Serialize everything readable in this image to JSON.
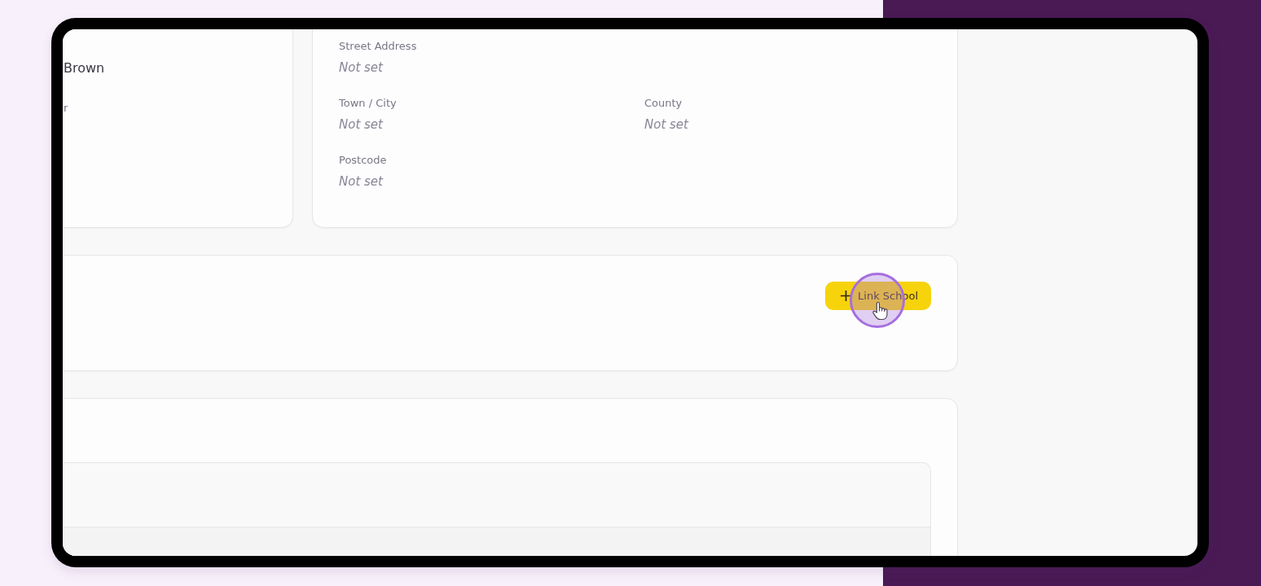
{
  "profile_card": {
    "name": "Brown",
    "field_label": "r"
  },
  "address_card": {
    "rows": [
      [
        {
          "label": "Street Address",
          "value": "Not set"
        }
      ],
      [
        {
          "label": "Town / City",
          "value": "Not set"
        },
        {
          "label": "County",
          "value": "Not set"
        }
      ],
      [
        {
          "label": "Postcode",
          "value": "Not set"
        }
      ]
    ]
  },
  "schools_card": {
    "button": {
      "label": "Link School"
    }
  }
}
